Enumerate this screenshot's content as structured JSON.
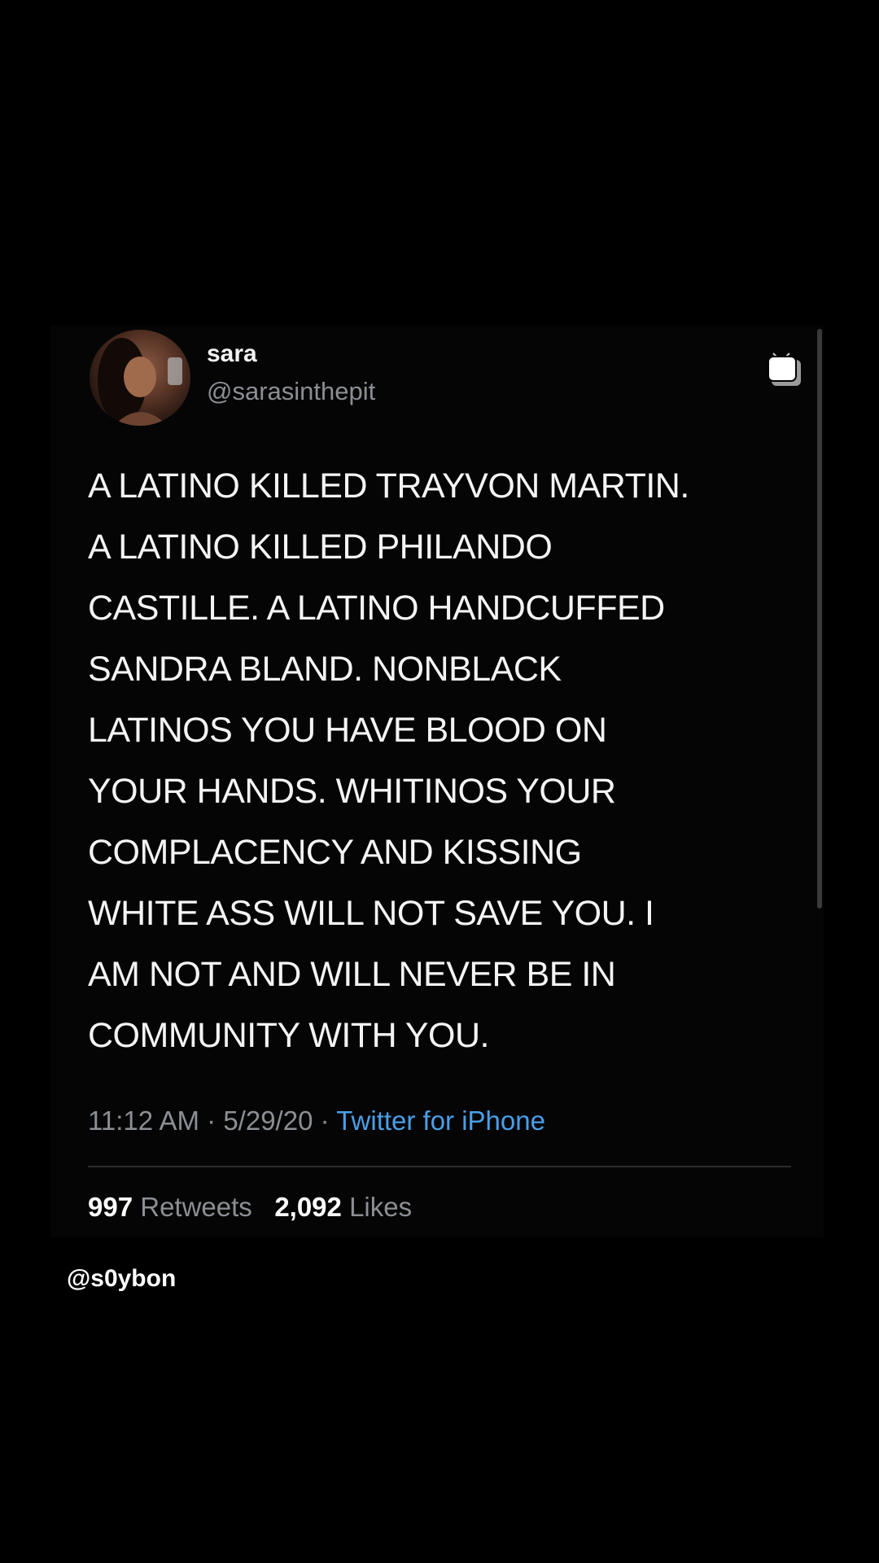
{
  "tweet": {
    "author": {
      "display_name": "sara",
      "handle": "@sarasinthepit"
    },
    "text": "A LATINO KILLED TRAYVON MARTIN.\nA LATINO KILLED PHILANDO\nCASTILLE. A LATINO HANDCUFFED\nSANDRA BLAND. NONBLACK\nLATINOS YOU HAVE BLOOD ON\nYOUR HANDS. WHITINOS YOUR\nCOMPLACENCY AND KISSING\nWHITE ASS WILL NOT SAVE YOU. I\nAM NOT AND WILL NEVER BE IN\nCOMMUNITY WITH YOU.",
    "time": "11:12 AM",
    "separator": "·",
    "date": "5/29/20",
    "source": "Twitter for iPhone",
    "retweets_count": "997",
    "retweets_label": "Retweets",
    "likes_count": "2,092",
    "likes_label": "Likes"
  },
  "watermark": "@s0ybon",
  "icons": {
    "avatar": "avatar",
    "media": "multiple-images-icon"
  },
  "colors": {
    "background": "#000000",
    "text": "#f4f4f4",
    "secondary_text": "#8b8f94",
    "link": "#4a9fe8"
  }
}
